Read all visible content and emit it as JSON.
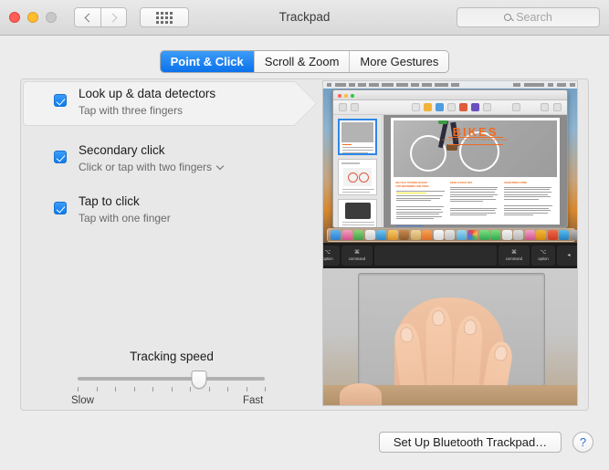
{
  "window": {
    "title": "Trackpad",
    "traffic_lights": [
      "close",
      "minimize",
      "zoom"
    ],
    "nav": {
      "back": "back-chevron",
      "forward": "forward-chevron"
    },
    "grid_button": "show-all-preferences",
    "search": {
      "placeholder": "Search",
      "value": "",
      "icon": "search-icon"
    }
  },
  "tabs": [
    {
      "label": "Point & Click",
      "active": true
    },
    {
      "label": "Scroll & Zoom",
      "active": false
    },
    {
      "label": "More Gestures",
      "active": false
    }
  ],
  "options": [
    {
      "title": "Look up & data detectors",
      "subtitle": "Tap with three fingers",
      "checked": true,
      "selected": true,
      "has_dropdown": false
    },
    {
      "title": "Secondary click",
      "subtitle": "Click or tap with two fingers",
      "checked": true,
      "selected": false,
      "has_dropdown": true
    },
    {
      "title": "Tap to click",
      "subtitle": "Tap with one finger",
      "checked": true,
      "selected": false,
      "has_dropdown": false
    }
  ],
  "slider": {
    "label": "Tracking speed",
    "min_label": "Slow",
    "max_label": "Fast",
    "value": 65,
    "tick_count": 11
  },
  "preview": {
    "description": "Three fingers tapping a MacBook trackpad with a Pages document on screen",
    "document_title": "BIKES",
    "document_subtitle": "ENJOY A RIDE, NOT THE RIDESHARE"
  },
  "footer": {
    "bluetooth_button": "Set Up Bluetooth Trackpad…",
    "help_button": "?"
  },
  "colors": {
    "accent": "#0a72ec",
    "checkbox": "#0a7cf0",
    "window_bg": "#ececec",
    "panel_bg": "#e8e8e8",
    "title_text": "#3a3a3a",
    "orange": "#ef6b22"
  }
}
